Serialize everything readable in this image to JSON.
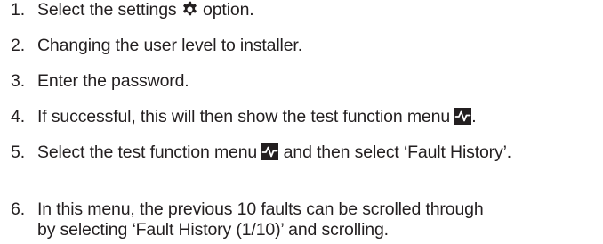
{
  "steps": [
    {
      "number": "1.",
      "before": "Select the settings ",
      "icon": "gear-icon",
      "after": " option."
    },
    {
      "number": "2.",
      "text": "Changing the user level to installer."
    },
    {
      "number": "3.",
      "text": "Enter the password."
    },
    {
      "number": "4.",
      "before": "If successful, this will then show the test function menu ",
      "icon": "test-function-icon",
      "after": "."
    },
    {
      "number": "5.",
      "before": "Select the test function menu ",
      "icon": "test-function-icon",
      "after": " and then select ‘Fault History’."
    },
    {
      "number": "6.",
      "line1": "In this menu, the previous 10 faults can be scrolled through",
      "line2": "by selecting ‘Fault History (1/10)’ and scrolling."
    }
  ],
  "colors": {
    "text": "#231f20",
    "icon_fill": "#231f20",
    "icon_background": "#231f20"
  }
}
